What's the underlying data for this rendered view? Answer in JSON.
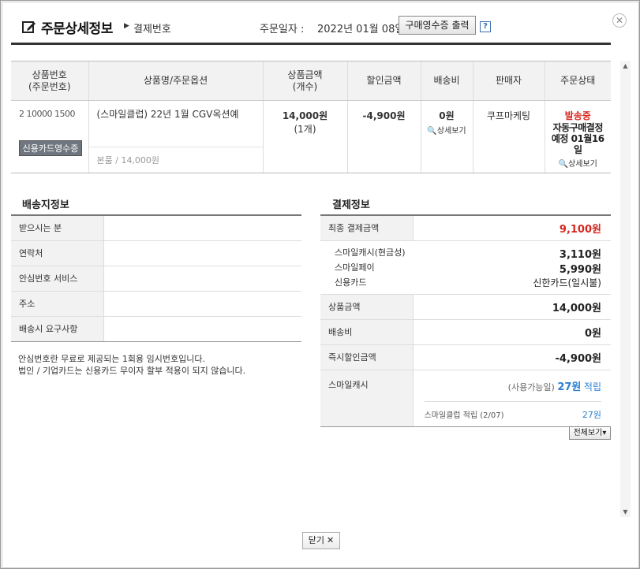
{
  "header": {
    "title": "주문상세정보",
    "crumb": "결제번호",
    "date_label": "주문일자 :",
    "date_value": "2022년 01월 08일",
    "receipt_button": "구매영수증 출력",
    "help": "?",
    "close": "✕"
  },
  "order_table": {
    "headers": {
      "order_no": [
        "상품번호",
        "(주문번호)"
      ],
      "product": "상품명/주문옵션",
      "price": [
        "상품금액",
        "(개수)"
      ],
      "discount": "할인금액",
      "shipping": "배송비",
      "seller": "판매자",
      "status": "주문상태"
    },
    "row": {
      "order_no": "2 10000 1500",
      "card_receipt_button": "신용카드영수증",
      "product_name": "(스마일클럽) 22년 1월 CGV옥션예",
      "product_option": "본품 / 14,000원",
      "price": "14,000원",
      "qty": "(1개)",
      "discount": "-4,900원",
      "shipping": "0원",
      "shipping_detail": "상세보기",
      "seller": "쿠프마케팅",
      "status_main": "발송중",
      "status_sub1": "자동구매결정",
      "status_sub2": "예정 01월16",
      "status_sub3": "일",
      "status_detail": "상세보기"
    }
  },
  "delivery": {
    "title": "배송지정보",
    "rows": [
      {
        "label": "받으시는 분",
        "value": ""
      },
      {
        "label": "연락처",
        "value": ""
      },
      {
        "label": "안심번호 서비스",
        "value": ""
      },
      {
        "label": "주소",
        "value": ""
      },
      {
        "label": "배송시 요구사항",
        "value": ""
      }
    ],
    "notice_1": "안심번호란 무료로 제공되는 1회용 임시번호입니다.",
    "notice_2": "법인 / 기업카드는 신용카드 무이자 할부 적용이 되지 않습니다."
  },
  "payment": {
    "title": "결제정보",
    "final_label": "최종 결제금액",
    "final_value": "9,100원",
    "methods": [
      {
        "label": "스마일캐시(현금성)",
        "value": "3,110원"
      },
      {
        "label": "스마일페이",
        "value": "5,990원"
      },
      {
        "label": "신용카드",
        "value": "신한카드(일시불)"
      }
    ],
    "product_label": "상품금액",
    "product_value": "14,000원",
    "shipping_label": "배송비",
    "shipping_value": "0원",
    "instant_label": "즉시할인금액",
    "instant_value": "-4,900원",
    "smile_label": "스마일캐시",
    "smile_avail": "(사용가능일)",
    "smile_amount": "27원",
    "smile_accrue": "적립",
    "club_label": "스마일클럽 적립 (2/07)",
    "club_value": "27원",
    "view_all": "전체보기"
  },
  "footer": {
    "close_label": "닫기",
    "close_x": "✕"
  },
  "colors": {
    "accent_red": "#d6251f",
    "accent_blue": "#2b7fd1"
  }
}
